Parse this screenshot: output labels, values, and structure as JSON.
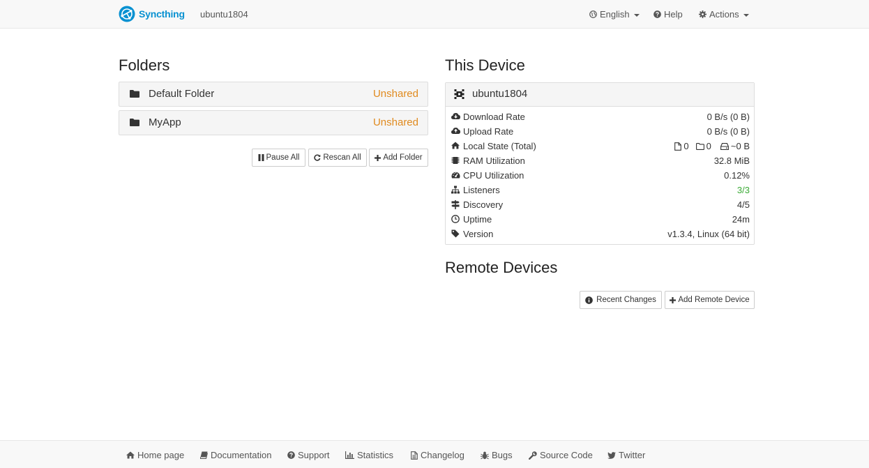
{
  "navbar": {
    "brand": "Syncthing",
    "device_name": "ubuntu1804",
    "language_label": "English",
    "help_label": "Help",
    "actions_label": "Actions"
  },
  "folders": {
    "heading": "Folders",
    "items": [
      {
        "name": "Default Folder",
        "status": "Unshared"
      },
      {
        "name": "MyApp",
        "status": "Unshared"
      }
    ],
    "buttons": {
      "pause_all": "Pause All",
      "rescan_all": "Rescan All",
      "add_folder": "Add Folder"
    }
  },
  "this_device": {
    "heading": "This Device",
    "name": "ubuntu1804",
    "stats": {
      "download_rate": {
        "label": "Download Rate",
        "value": "0 B/s (0 B)"
      },
      "upload_rate": {
        "label": "Upload Rate",
        "value": "0 B/s (0 B)"
      },
      "local_state": {
        "label": "Local State (Total)",
        "files": "0",
        "dirs": "0",
        "size": "~0 B"
      },
      "ram": {
        "label": "RAM Utilization",
        "value": "32.8 MiB"
      },
      "cpu": {
        "label": "CPU Utilization",
        "value": "0.12%"
      },
      "listeners": {
        "label": "Listeners",
        "value": "3/3"
      },
      "discovery": {
        "label": "Discovery",
        "value": "4/5"
      },
      "uptime": {
        "label": "Uptime",
        "value": "24m"
      },
      "version": {
        "label": "Version",
        "value": "v1.3.4, Linux (64 bit)"
      }
    }
  },
  "remote_devices": {
    "heading": "Remote Devices",
    "buttons": {
      "recent_changes": "Recent Changes",
      "add_remote_device": "Add Remote Device"
    }
  },
  "footer": {
    "home_page": "Home page",
    "documentation": "Documentation",
    "support": "Support",
    "statistics": "Statistics",
    "changelog": "Changelog",
    "bugs": "Bugs",
    "source_code": "Source Code",
    "twitter": "Twitter"
  },
  "colors": {
    "brand": "#0891d1",
    "unshared": "#e08a1e",
    "listeners_ok": "#3aaa35"
  }
}
